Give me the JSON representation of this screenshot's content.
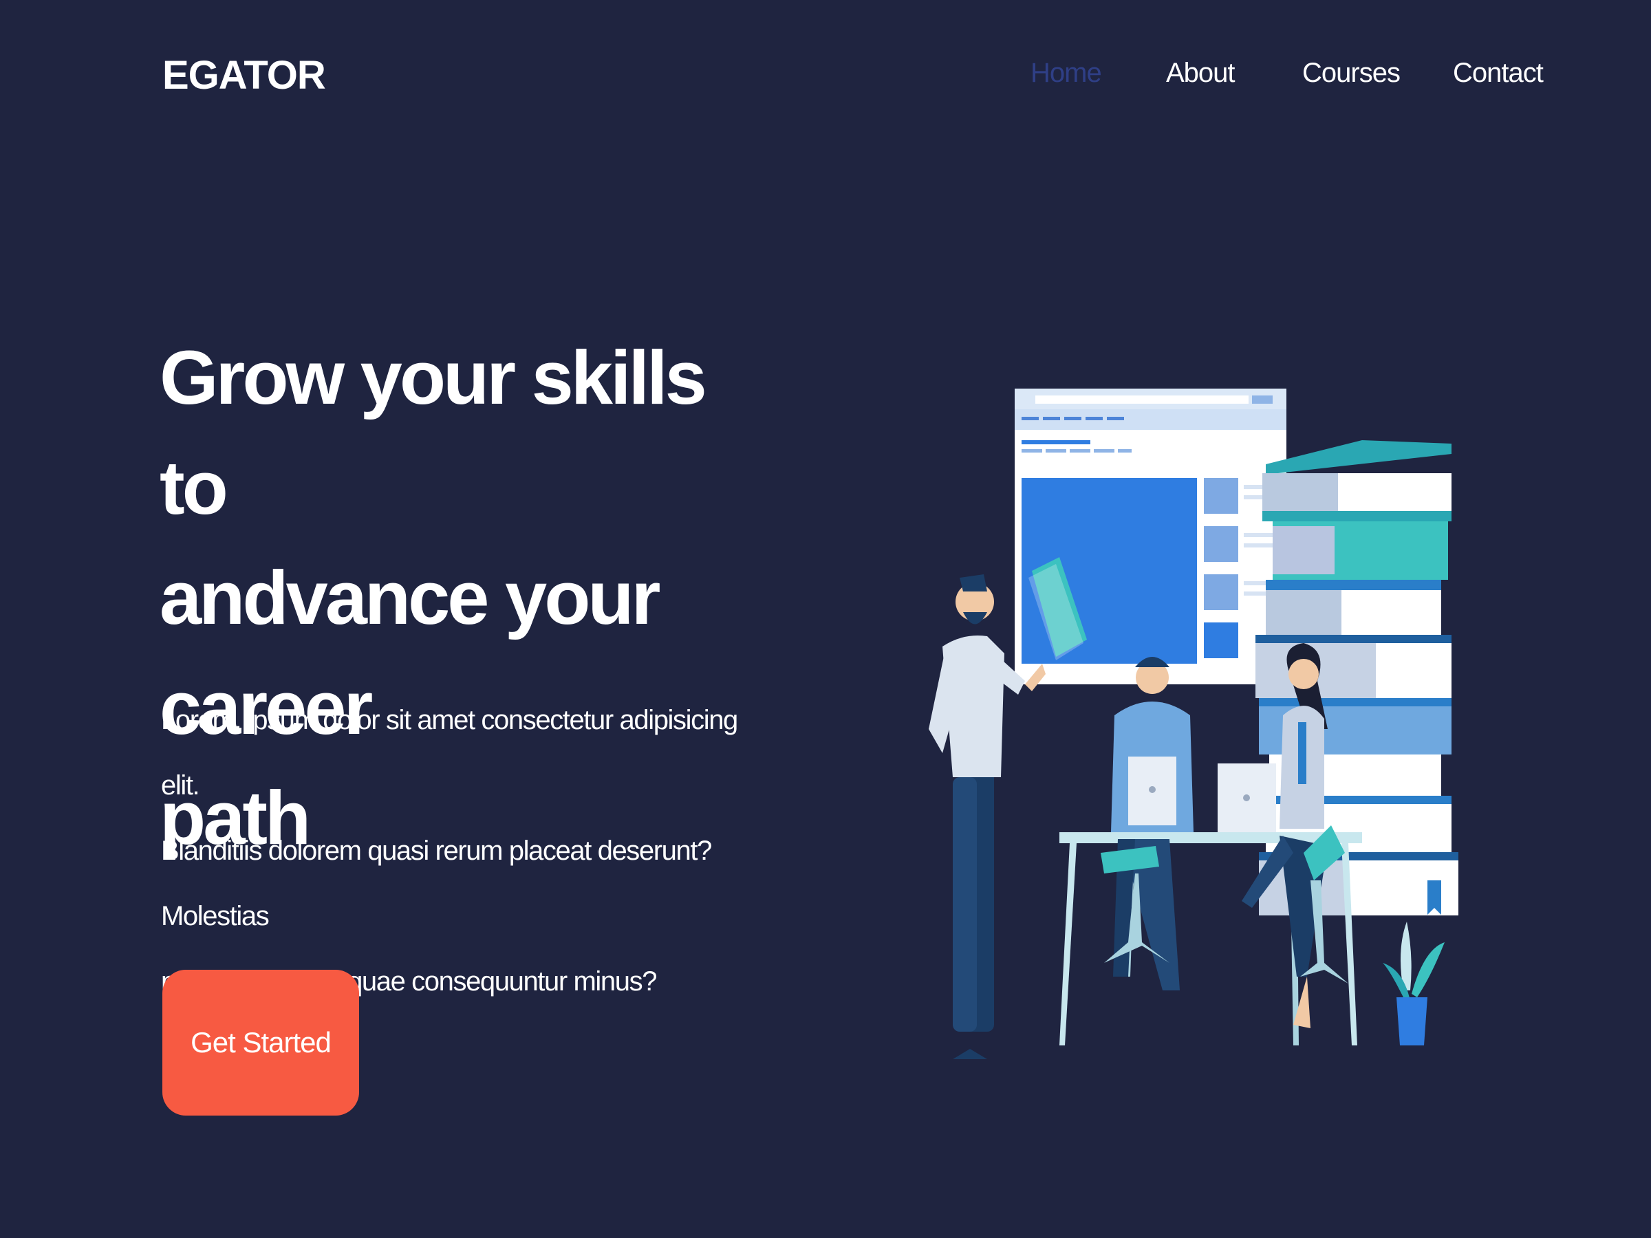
{
  "brand": {
    "name": "EGATOR"
  },
  "nav": {
    "items": [
      {
        "label": "Home",
        "active": true
      },
      {
        "label": "About",
        "active": false
      },
      {
        "label": "Courses",
        "active": false
      },
      {
        "label": "Contact",
        "active": false
      }
    ]
  },
  "hero": {
    "title_lines": [
      "Grow your skills to",
      "andvance your career",
      "path"
    ],
    "text_lines": [
      "Lorem, ipsum dolor sit amet consectetur adipisicing elit.",
      "Blanditiis dolorem quasi rerum placeat deserunt? Molestias",
      "praesentium vel quae consequuntur minus?"
    ],
    "cta_label": "Get Started"
  },
  "colors": {
    "background": "#1f2440",
    "accent": "#f75a42",
    "nav_active": "#2f3f86",
    "text": "#ffffff"
  },
  "illustration": {
    "icon": "team-learning-illustration"
  }
}
